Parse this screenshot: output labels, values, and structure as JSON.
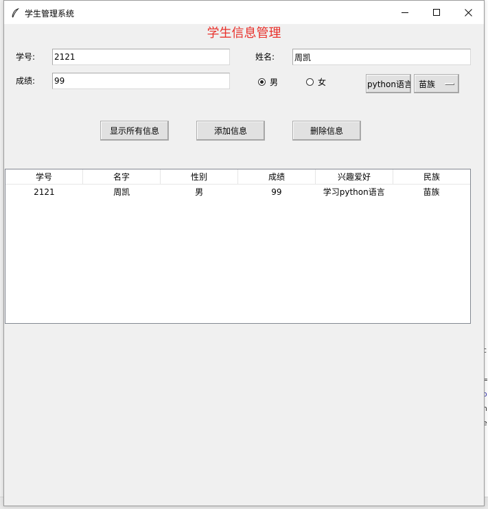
{
  "window": {
    "title": "学生管理系统"
  },
  "heading": "学生信息管理",
  "form": {
    "student_id_label": "学号:",
    "student_id_value": "2121",
    "name_label": "姓名:",
    "name_value": "周凯",
    "score_label": "成绩:",
    "score_value": "99",
    "gender_options": [
      {
        "label": "男",
        "selected": true
      },
      {
        "label": "女",
        "selected": false
      }
    ],
    "hobby_select": "python语言",
    "ethnicity_select": "苗族"
  },
  "actions": {
    "show_all": "显示所有信息",
    "add": "添加信息",
    "delete": "删除信息"
  },
  "table": {
    "columns": [
      "学号",
      "名字",
      "性别",
      "成绩",
      "兴趣爱好",
      "民族"
    ],
    "rows": [
      [
        "2121",
        "周凯",
        "男",
        "99",
        "学习python语言",
        "苗族"
      ]
    ]
  },
  "icons": {
    "app": "feather-icon",
    "minimize": "minimize-icon",
    "maximize": "maximize-icon",
    "close": "close-icon"
  }
}
